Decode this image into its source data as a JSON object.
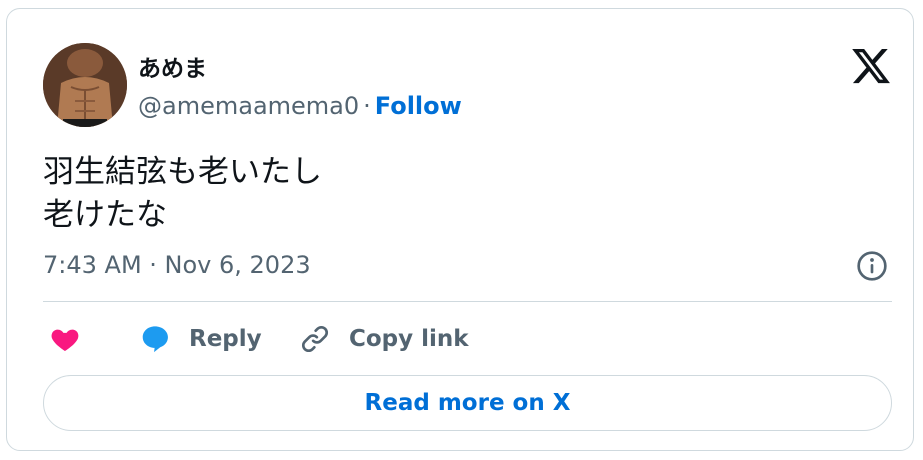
{
  "author": {
    "display_name": "あめま",
    "handle": "@amemaamema0",
    "separator": "·",
    "follow_label": "Follow"
  },
  "tweet": {
    "lines": [
      "羽生結弦も老いたし",
      "老けたな"
    ],
    "timestamp": "7:43 AM · Nov 6, 2023"
  },
  "actions": {
    "reply_label": "Reply",
    "copy_label": "Copy link"
  },
  "read_more_label": "Read more on X",
  "colors": {
    "link": "#006fd6",
    "like": "#f91880",
    "reply": "#1d9bf0",
    "muted": "#536471",
    "border": "#cfd9de"
  },
  "icons": [
    "avatar",
    "x-logo-icon",
    "info-icon",
    "heart-icon",
    "reply-bubble-icon",
    "link-icon"
  ]
}
